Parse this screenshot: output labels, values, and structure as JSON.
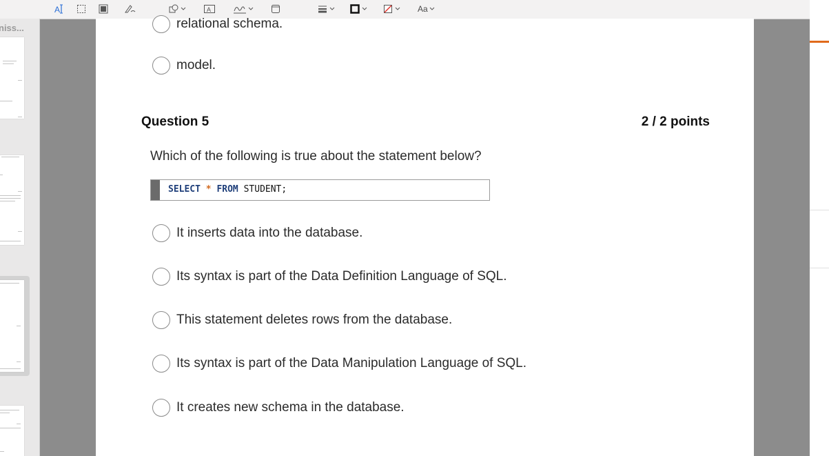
{
  "toolbar": {
    "tools": [
      "text-select-icon",
      "rect-select-icon",
      "redact-icon",
      "sketch-icon",
      "shapes-icon",
      "text-box-icon",
      "sign-icon",
      "note-icon",
      "line-style-icon",
      "border-color-icon",
      "fill-color-icon"
    ],
    "font_label": "Aa"
  },
  "sidebar": {
    "title": "niss..."
  },
  "document": {
    "prev_options": [
      "relational schema.",
      "model."
    ],
    "question": {
      "title": "Question 5",
      "points": "2 / 2 points",
      "prompt": "Which of the following is true about the statement below?",
      "code": {
        "kw1": "SELECT",
        "star": "*",
        "kw2": "FROM",
        "rest": "STUDENT;"
      },
      "options": [
        "It inserts data into the database.",
        "Its syntax is part of the Data Definition Language of SQL.",
        "This statement deletes rows from the database.",
        "Its syntax is part of the Data Manipulation Language of SQL.",
        "It creates new schema in the database."
      ]
    }
  },
  "colors": {
    "accent": "#e06a1b",
    "code_keyword": "#1f3f7a",
    "code_star": "#d2691e",
    "canvas": "#8c8c8c"
  }
}
